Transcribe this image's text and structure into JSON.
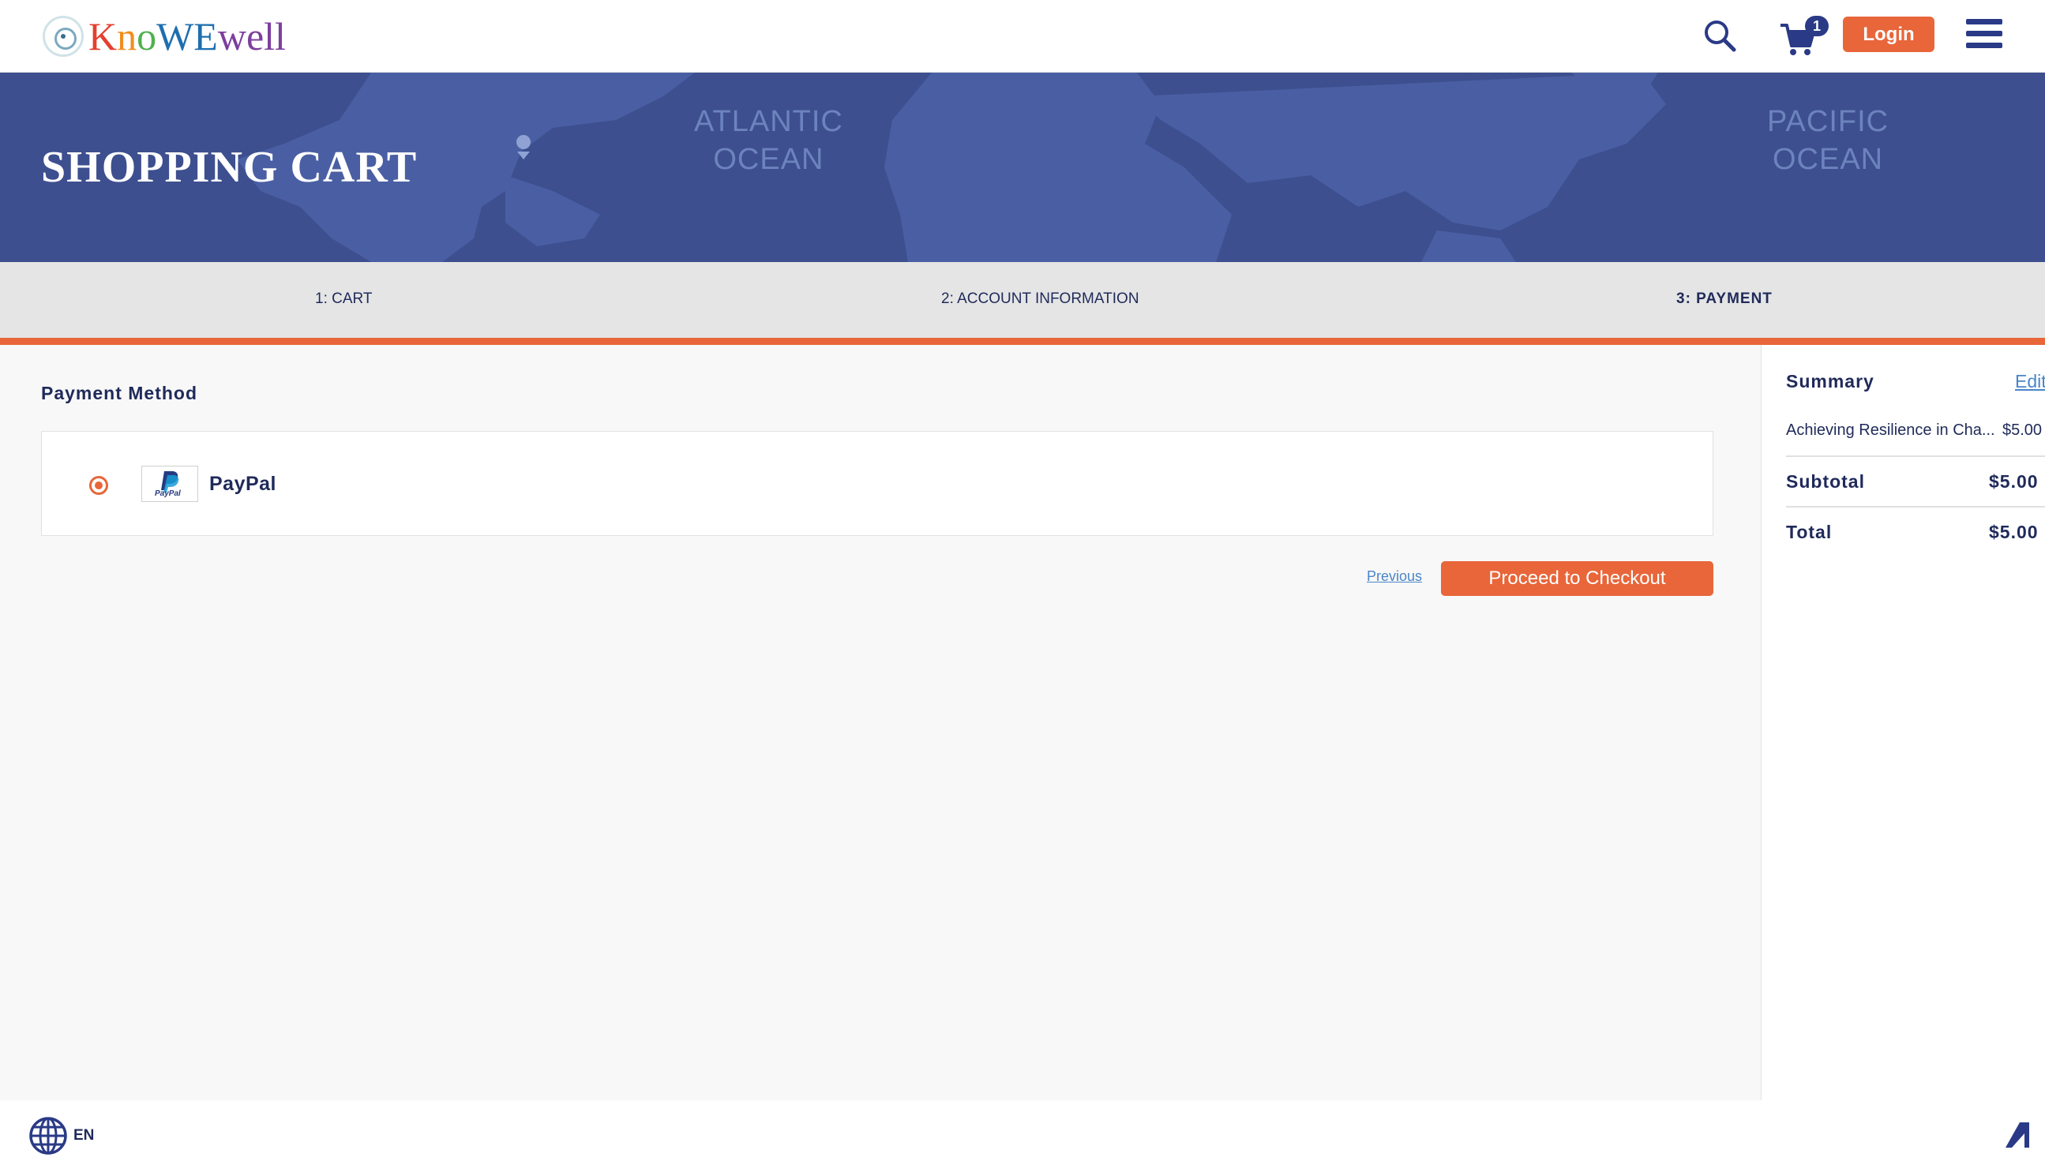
{
  "brand": {
    "logo_text": "KnoWEwell",
    "accent_color": "#e8663a",
    "navy_color": "#2a3a86"
  },
  "header": {
    "search_icon": "search-icon",
    "cart_icon": "cart-icon",
    "cart_count": "1",
    "login_label": "Login",
    "menu_icon": "hamburger-menu-icon"
  },
  "banner": {
    "title": "SHOPPING CART",
    "oceans": [
      "ATLANTIC",
      "OCEAN",
      "PACIFIC",
      "OCEAN"
    ]
  },
  "steps": [
    {
      "label": "1: CART",
      "active": false
    },
    {
      "label": "2: ACCOUNT INFORMATION",
      "active": false
    },
    {
      "label": "3: PAYMENT",
      "active": true
    }
  ],
  "payment": {
    "title": "Payment Method",
    "methods": [
      {
        "label": "PayPal",
        "selected": true,
        "logo_text": "PayPal"
      }
    ],
    "previous_label": "Previous",
    "checkout_label": "Proceed to Checkout"
  },
  "summary": {
    "title": "Summary",
    "edit_label": "Edit",
    "items": [
      {
        "name": "Achieving Resilience in Cha...",
        "price": "$5.00"
      }
    ],
    "subtotal_label": "Subtotal",
    "subtotal_value": "$5.00",
    "total_label": "Total",
    "total_value": "$5.00"
  },
  "footer": {
    "language": "EN",
    "globe_icon": "globe-icon",
    "accessibility_icon": "accessibility-icon"
  }
}
